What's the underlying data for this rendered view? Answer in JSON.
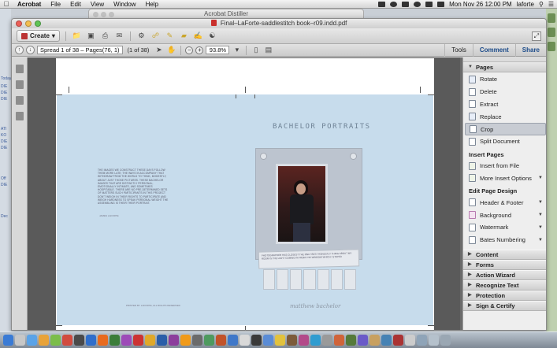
{
  "menubar": {
    "app_name": "Acrobat",
    "items": [
      "File",
      "Edit",
      "View",
      "Window",
      "Help"
    ],
    "clock": "Mon Nov 26  12:00 PM",
    "user": "laforte"
  },
  "background_window": {
    "title": "Acrobat Distiller"
  },
  "window": {
    "title": "Final–LaForte-saddlestitch book–r09.indd.pdf"
  },
  "toolbar": {
    "create_label": "Create",
    "spread_field": "Spread 1 of 38 – Pages(76, 1)",
    "page_count": "(1 of 38)",
    "zoom": "93.8%",
    "tabs": [
      "Tools",
      "Comment",
      "Share"
    ]
  },
  "document": {
    "spread_title": "BACHELOR PORTRAITS",
    "body_text": "THE IMAGES WE CONSTRUCT THESE DAYS FOLLOW THEM MORE LATE; THE WAYS IN ACCOMPANY THAT WITHDRAW FROM THE WORLD TO THINK, MODESTLY, ABOUT JUST THOSE PICTURES. THESE BACHELOR IMAGES THAT ARE DISTINCTLY PERSONAL; EMOTIONALLY INTIMATE, AND SOMETIMES HOSPITABLE. THERE ARE NO PRE-DETERMINED SETS OF MATTERS SUCH PARTICIPANTS IN THIS PROJECT DON'T WEIGH IN THEIR RIGHTS TO PARTICIPATE AND WEIGH HARDNESS TO SPEAK PERSONAL WEIGHT THE ASSEMBLING IS THEIR THEIR PORTRAIT.",
    "caption": "JAMES LAFORTE",
    "footer": "PRINTED BY LAFORTE, ALL RIGHTS RESERVED",
    "handwritten_note": "PHOTOGRAPHER HAS CLOSEST THE ONLY BEST HONESTLY THING ABOUT MY ROOM IS THE LIGHT COMING IN FROM THE WINDOW WHICH I STAYED",
    "signature": "matthew bachelor"
  },
  "pane": {
    "pages_header": "Pages",
    "pages_items": [
      {
        "label": "Rotate"
      },
      {
        "label": "Delete"
      },
      {
        "label": "Extract"
      },
      {
        "label": "Replace"
      },
      {
        "label": "Crop"
      },
      {
        "label": "Split Document"
      }
    ],
    "insert_header": "Insert Pages",
    "insert_items": [
      {
        "label": "Insert from File"
      },
      {
        "label": "More Insert Options"
      }
    ],
    "design_header": "Edit Page Design",
    "design_items": [
      {
        "label": "Header & Footer"
      },
      {
        "label": "Background"
      },
      {
        "label": "Watermark"
      },
      {
        "label": "Bates Numbering"
      }
    ],
    "sections": [
      "Content",
      "Forms",
      "Action Wizard",
      "Recognize Text",
      "Protection",
      "Sign & Certify"
    ]
  },
  "colors": {
    "spread_background": "#c7dcec",
    "selected_item": "#c8ccd3",
    "active_tab": "#1d4c8a"
  }
}
